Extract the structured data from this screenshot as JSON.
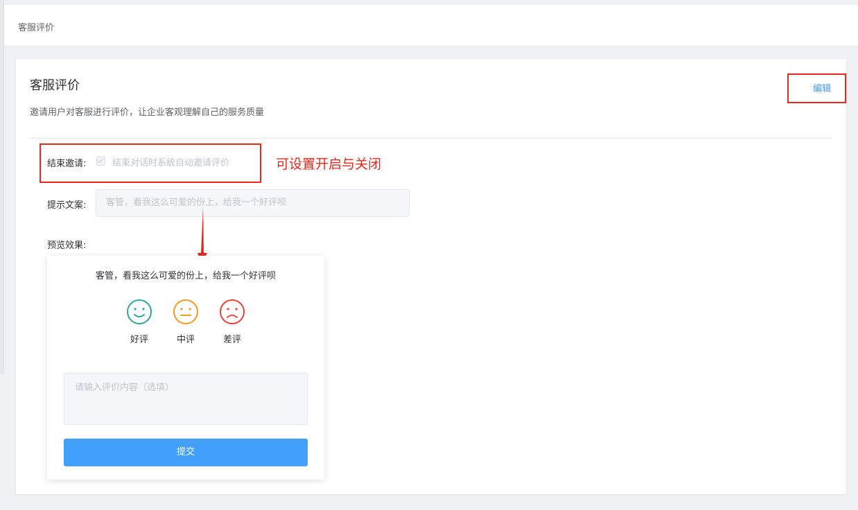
{
  "breadcrumb": "客服评价",
  "card": {
    "title": "客服评价",
    "description": "邀请用户对客服进行评价，让企业客观理解自己的服务质量",
    "edit_label": "编辑"
  },
  "form": {
    "invite_label": "结束邀请:",
    "invite_checked": true,
    "invite_text": "结束对话时系统自动邀请评价",
    "tip_label": "提示文案:",
    "tip_value": "客管，看我这么可爱的份上，给我一个好评呗",
    "preview_label": "预览效果:"
  },
  "annotation": "可设置开启与关闭",
  "preview": {
    "prompt": "客管，看我这么可爱的份上，给我一个好评呗",
    "ratings": [
      {
        "label": "好评",
        "icon": "smile-face-icon",
        "color": "#2ba69a"
      },
      {
        "label": "中评",
        "icon": "neutral-face-icon",
        "color": "#f29a1f"
      },
      {
        "label": "差评",
        "icon": "sad-face-icon",
        "color": "#ee4037"
      }
    ],
    "comment_placeholder": "请输入评价内容（选填）",
    "submit_label": "提交"
  },
  "colors": {
    "accent": "#409eff",
    "button": "#42a0fb",
    "annotation": "#e8281e"
  }
}
